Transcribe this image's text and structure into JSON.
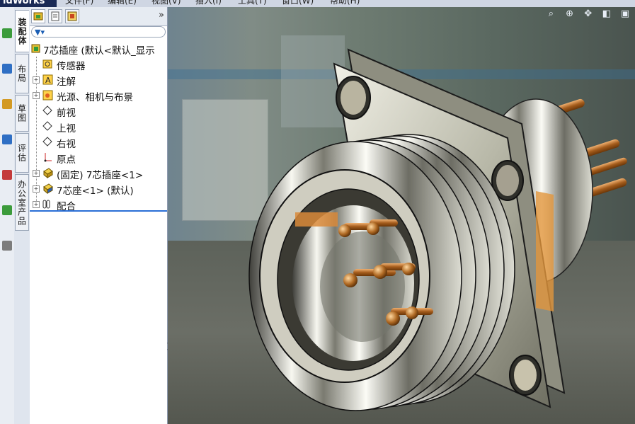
{
  "app": {
    "brand": "idWorks"
  },
  "menu": [
    "文件(F)",
    "编辑(E)",
    "视图(V)",
    "插入(I)",
    "工具(T)",
    "窗口(W)",
    "帮助(H)"
  ],
  "vertical_tabs": [
    {
      "label": "装配体"
    },
    {
      "label": "布局"
    },
    {
      "label": "草图"
    },
    {
      "label": "评估"
    },
    {
      "label": "办公室产品"
    }
  ],
  "panel": {
    "expand_glyph": "»",
    "tree": [
      {
        "label": "7芯插座  (默认<默认_显示",
        "icon": "assembly-icon"
      },
      {
        "label": "传感器",
        "icon": "sensor-icon"
      },
      {
        "label": "注解",
        "icon": "annotation-icon"
      },
      {
        "label": "光源、相机与布景",
        "icon": "lights-icon"
      },
      {
        "label": "前视",
        "icon": "plane-icon"
      },
      {
        "label": "上视",
        "icon": "plane-icon"
      },
      {
        "label": "右视",
        "icon": "plane-icon"
      },
      {
        "label": "原点",
        "icon": "origin-icon"
      },
      {
        "label": "(固定) 7芯插座<1>",
        "icon": "part-icon"
      },
      {
        "label": "7芯座<1> (默认)",
        "icon": "part-icon"
      },
      {
        "label": "配合",
        "icon": "mates-icon"
      }
    ]
  },
  "viewport_tools": [
    "zoom-fit-icon",
    "zoom-area-icon",
    "pan-icon",
    "view-orientation-icon",
    "display-style-icon"
  ]
}
